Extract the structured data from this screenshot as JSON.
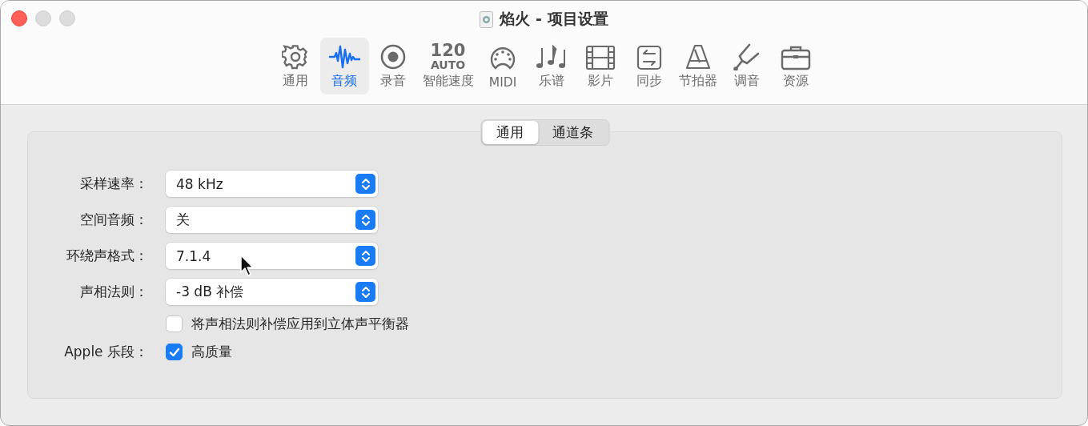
{
  "window": {
    "title": "焰火 - 项目设置"
  },
  "toolbar": [
    {
      "kind": "gear",
      "label": "通用",
      "selected": false
    },
    {
      "kind": "waveform",
      "label": "音频",
      "selected": true
    },
    {
      "kind": "record",
      "label": "录音",
      "selected": false
    },
    {
      "kind": "tempo",
      "tempo": "120",
      "mode": "AUTO",
      "label": "智能速度",
      "selected": false
    },
    {
      "kind": "midi",
      "label": "MIDI",
      "selected": false
    },
    {
      "kind": "notes",
      "label": "乐谱",
      "selected": false
    },
    {
      "kind": "film",
      "label": "影片",
      "selected": false
    },
    {
      "kind": "sync",
      "label": "同步",
      "selected": false
    },
    {
      "kind": "metronome",
      "label": "节拍器",
      "selected": false
    },
    {
      "kind": "fork",
      "label": "调音",
      "selected": false
    },
    {
      "kind": "briefcase",
      "label": "资源",
      "selected": false
    }
  ],
  "tabs": [
    {
      "label": "通用",
      "selected": true
    },
    {
      "label": "通道条",
      "selected": false
    }
  ],
  "settings": [
    {
      "kind": "popup",
      "label": "采样速率：",
      "value": "48 kHz"
    },
    {
      "kind": "popup",
      "label": "空间音频：",
      "value": "关"
    },
    {
      "kind": "popup",
      "label": "环绕声格式：",
      "value": "7.1.4"
    },
    {
      "kind": "popup",
      "label": "声相法则：",
      "value": "-3 dB 补偿"
    },
    {
      "kind": "checkbox",
      "text": "将声相法则补偿应用到立体声平衡器",
      "checked": false
    },
    {
      "kind": "checkbox",
      "label": "Apple 乐段：",
      "text": "高质量",
      "checked": true
    }
  ]
}
